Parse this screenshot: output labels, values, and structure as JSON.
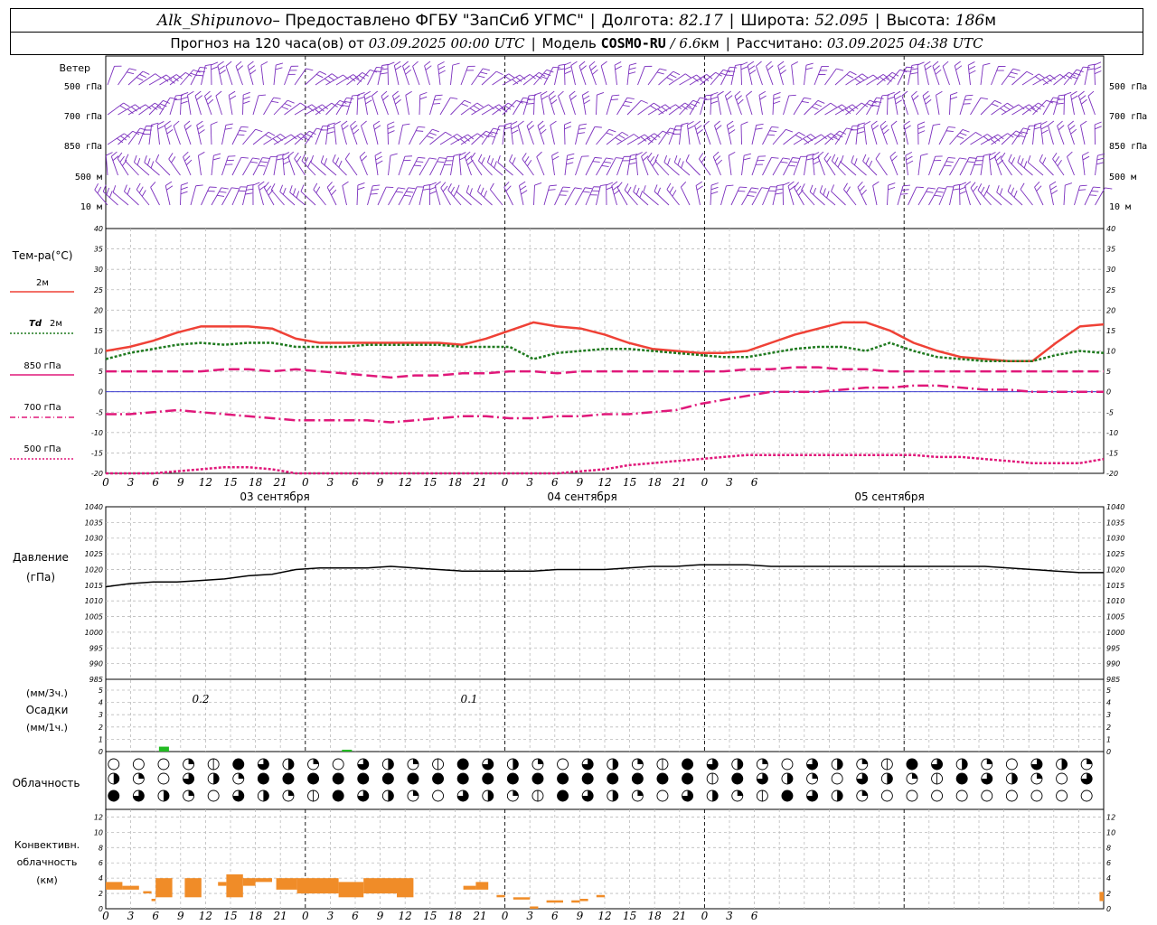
{
  "header": {
    "station": "Alk_Shipunovo",
    "provider": " – Предоставлено ФГБУ \"ЗапСиб УГМС\"",
    "lon_label": "Долгота:",
    "lon_value": "82.17",
    "lat_label": "Широта:",
    "lat_value": "52.095",
    "alt_label": "Высота:",
    "alt_value": "186",
    "alt_unit": "м",
    "forecast_label": "Прогноз на 120 часа(ов) от",
    "forecast_start": "03.09.2025 00:00 UTC",
    "model_label": "Модель",
    "model_name": "COSMO-RU",
    "model_res": "/ 6.6",
    "model_res_unit": "км",
    "calc_label": "Рассчитано:",
    "calc_time": "03.09.2025 04:38 UTC"
  },
  "labels": {
    "wind": "Ветер",
    "wind_levels": [
      "500 гПа",
      "700 гПа",
      "850 гПа",
      "500 м",
      "10 м"
    ],
    "wind_levels_right": [
      "500 гПа",
      "700 гПа",
      "850 гПа",
      "500 м",
      "10 м"
    ],
    "temp_title": "Тем-ра(°С)",
    "t2m": "2м",
    "td": "Td",
    "td2m": "2м",
    "t850": "850 гПа",
    "t700": "700 гПа",
    "t500": "500 гПа",
    "pressure_1": "Давление",
    "pressure_2": "(гПа)",
    "precip_1": "(мм/3ч.)",
    "precip_2": "Осадки",
    "precip_3": "(мм/1ч.)",
    "cloud": "Облачность",
    "conv_1": "Конвективн.",
    "conv_2": "облачность",
    "conv_3": "(км)",
    "dates": [
      "03 сентября",
      "04 сентября",
      "05 сентября"
    ]
  },
  "colors": {
    "t2m": "#ef4136",
    "td": "#1f7a1f",
    "t850": "#e0187a",
    "t700": "#e0187a",
    "t500": "#e0187a",
    "wind": "#7b2fbe",
    "pressure": "#000000",
    "precip": "#22bb22",
    "conv": "#f08c28",
    "zero": "#2222cc"
  },
  "chart_data": [
    {
      "type": "line",
      "name": "wind",
      "note_levels": [
        "500 гПа",
        "700 гПа",
        "850 гПа",
        "500 м",
        "10 м"
      ]
    },
    {
      "type": "line",
      "name": "temperature",
      "x_hours_step": 3,
      "xticks": [
        "0",
        "3",
        "6",
        "9",
        "12",
        "15",
        "18",
        "21",
        "0",
        "3",
        "6",
        "9",
        "12",
        "15",
        "18",
        "21",
        "0",
        "3",
        "6",
        "9",
        "12",
        "15",
        "18",
        "21",
        "0",
        "3",
        "6"
      ],
      "ylim": [
        -20,
        40
      ],
      "yticks": [
        40,
        35,
        30,
        25,
        20,
        15,
        10,
        5,
        0,
        -5,
        -10,
        -15,
        -20
      ],
      "series": [
        {
          "name": "2м",
          "values": [
            10,
            11,
            12.5,
            14.5,
            16,
            16,
            16,
            15.5,
            13,
            12,
            12,
            12,
            12,
            12,
            12,
            11.5,
            13,
            15,
            17,
            16,
            15.5,
            14,
            12,
            10.5,
            10,
            9.5,
            9.5,
            10,
            12,
            14,
            15.5,
            17,
            17,
            15,
            12,
            10,
            8.5,
            8,
            7.5,
            7.5,
            12,
            16,
            16.5
          ]
        },
        {
          "name": "Td 2м",
          "values": [
            8,
            9.5,
            10.5,
            11.5,
            12,
            11.5,
            12,
            12,
            11,
            11,
            11,
            11.5,
            11.5,
            11.5,
            11.5,
            11,
            11,
            11,
            8,
            9.5,
            10,
            10.5,
            10.5,
            10,
            9.5,
            9,
            8.5,
            8.5,
            9.5,
            10.5,
            11,
            11,
            10,
            12,
            10,
            8.5,
            8,
            7.5,
            7.5,
            7.5,
            9,
            10,
            9.5
          ]
        },
        {
          "name": "850 гПа",
          "values": [
            5,
            5,
            5,
            5,
            5,
            5.5,
            5.5,
            5,
            5.5,
            5,
            4.5,
            4,
            3.5,
            4,
            4,
            4.5,
            4.5,
            5,
            5,
            4.5,
            5,
            5,
            5,
            5,
            5,
            5,
            5,
            5.5,
            5.5,
            6,
            6,
            5.5,
            5.5,
            5,
            5,
            5,
            5,
            5,
            5,
            5,
            5,
            5,
            5
          ]
        },
        {
          "name": "700 гПа",
          "values": [
            -5.5,
            -5.5,
            -5,
            -4.5,
            -5,
            -5.5,
            -6,
            -6.5,
            -7,
            -7,
            -7,
            -7,
            -7.5,
            -7,
            -6.5,
            -6,
            -6,
            -6.5,
            -6.5,
            -6,
            -6,
            -5.5,
            -5.5,
            -5,
            -4.5,
            -3,
            -2,
            -1,
            0,
            0,
            0,
            0.5,
            1,
            1,
            1.5,
            1.5,
            1,
            0.5,
            0.5,
            0,
            0,
            0,
            0
          ]
        },
        {
          "name": "500 гПа",
          "values": [
            -21,
            -20.5,
            -20,
            -19.5,
            -19,
            -18.5,
            -18.5,
            -19,
            -20,
            -20.5,
            -21,
            -21.5,
            -22,
            -22,
            -21.5,
            -21,
            -21,
            -21,
            -20.5,
            -20,
            -19.5,
            -19,
            -18,
            -17.5,
            -17,
            -16.5,
            -16,
            -15.5,
            -15.5,
            -15.5,
            -15.5,
            -15.5,
            -15.5,
            -15.5,
            -15.5,
            -16,
            -16,
            -16.5,
            -17,
            -17.5,
            -17.5,
            -17.5,
            -16.5
          ]
        }
      ]
    },
    {
      "type": "line",
      "name": "pressure",
      "ylim": [
        985,
        1040
      ],
      "yticks": [
        1040,
        1035,
        1030,
        1025,
        1020,
        1015,
        1010,
        1005,
        1000,
        995,
        990,
        985
      ],
      "series": [
        {
          "name": "Давление",
          "values": [
            1014.5,
            1015.5,
            1016,
            1016,
            1016.5,
            1017,
            1018,
            1018.5,
            1020,
            1020.5,
            1020.5,
            1020.5,
            1021,
            1020.5,
            1020,
            1019.5,
            1019.5,
            1019.5,
            1019.5,
            1020,
            1020,
            1020,
            1020.5,
            1021,
            1021,
            1021.5,
            1021.5,
            1021.5,
            1021,
            1021,
            1021,
            1021,
            1021,
            1021,
            1021,
            1021,
            1021,
            1021,
            1020.5,
            1020,
            1019.5,
            1019,
            1019
          ]
        }
      ]
    },
    {
      "type": "bar",
      "name": "precipitation",
      "ylim": [
        0,
        5
      ],
      "yticks": [
        5,
        4,
        3,
        2,
        1,
        0
      ],
      "annotations": [
        "0.2",
        "0.1"
      ],
      "bars": [
        {
          "hour": 7,
          "value": 0.4
        },
        {
          "hour": 29,
          "value": 0.15
        }
      ]
    },
    {
      "type": "table",
      "name": "cloudiness",
      "rows": 3,
      "columns": 40
    },
    {
      "type": "bar",
      "name": "convective_clouds",
      "ylim": [
        0,
        13
      ],
      "yticks": [
        12,
        10,
        8,
        6,
        4,
        2,
        0
      ],
      "bars": [
        {
          "h0": 0,
          "h1": 2,
          "base": 2.5,
          "top": 3.5
        },
        {
          "h0": 2,
          "h1": 4,
          "base": 2.5,
          "top": 3
        },
        {
          "h0": 4.5,
          "h1": 5.5,
          "base": 2,
          "top": 2.3
        },
        {
          "h0": 5.5,
          "h1": 6,
          "base": 1,
          "top": 1.3
        },
        {
          "h0": 6,
          "h1": 8,
          "base": 1.5,
          "top": 4
        },
        {
          "h0": 9.5,
          "h1": 11.5,
          "base": 1.5,
          "top": 4
        },
        {
          "h0": 13.5,
          "h1": 14.5,
          "base": 3,
          "top": 3.5
        },
        {
          "h0": 14.5,
          "h1": 16.5,
          "base": 1.5,
          "top": 4.5
        },
        {
          "h0": 16.5,
          "h1": 18,
          "base": 3,
          "top": 4
        },
        {
          "h0": 18,
          "h1": 20,
          "base": 3.5,
          "top": 4
        },
        {
          "h0": 20.5,
          "h1": 23,
          "base": 2.5,
          "top": 4
        },
        {
          "h0": 23,
          "h1": 28,
          "base": 2,
          "top": 4
        },
        {
          "h0": 28,
          "h1": 31,
          "base": 1.5,
          "top": 3.5
        },
        {
          "h0": 31,
          "h1": 35,
          "base": 2,
          "top": 4
        },
        {
          "h0": 35,
          "h1": 37,
          "base": 1.5,
          "top": 4
        },
        {
          "h0": 43,
          "h1": 44.5,
          "base": 2.5,
          "top": 3
        },
        {
          "h0": 44.5,
          "h1": 46,
          "base": 2.5,
          "top": 3.5
        },
        {
          "h0": 47,
          "h1": 48,
          "base": 1.5,
          "top": 1.8
        },
        {
          "h0": 49,
          "h1": 51,
          "base": 1.2,
          "top": 1.5
        },
        {
          "h0": 51,
          "h1": 52,
          "base": 0,
          "top": 0.3
        },
        {
          "h0": 53,
          "h1": 55,
          "base": 0.8,
          "top": 1.1
        },
        {
          "h0": 56,
          "h1": 57,
          "base": 0.8,
          "top": 1.1
        },
        {
          "h0": 57,
          "h1": 58,
          "base": 1,
          "top": 1.3
        },
        {
          "h0": 59,
          "h1": 60,
          "base": 1.5,
          "top": 1.8
        },
        {
          "h0": 119.5,
          "h1": 120,
          "base": 1,
          "top": 2.2
        }
      ]
    }
  ]
}
